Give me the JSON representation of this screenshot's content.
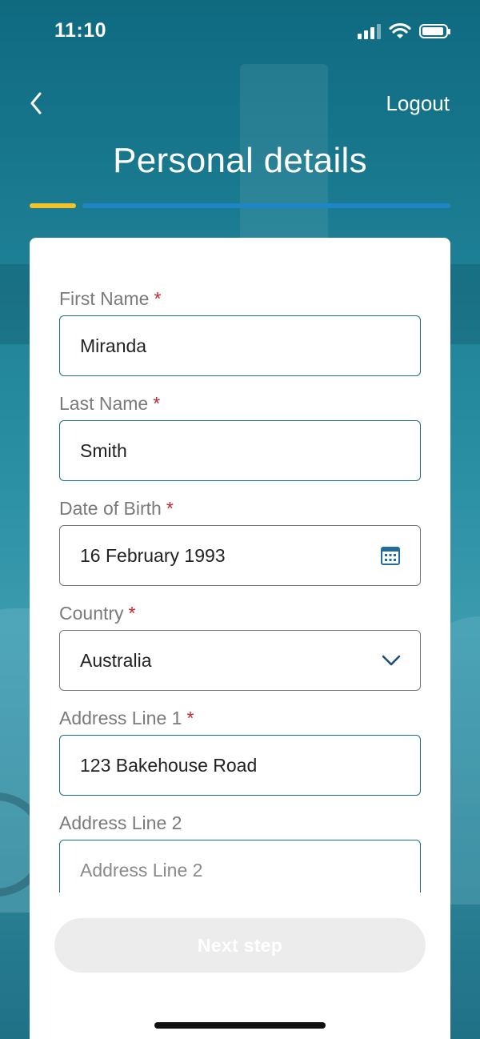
{
  "status_bar": {
    "time": "11:10"
  },
  "header": {
    "logout_label": "Logout",
    "title": "Personal details"
  },
  "progress": {
    "current_step": 1,
    "fraction_complete": 0.11
  },
  "form": {
    "first_name": {
      "label": "First Name",
      "required_mark": "*",
      "value": "Miranda"
    },
    "last_name": {
      "label": "Last Name",
      "required_mark": "*",
      "value": "Smith"
    },
    "date_of_birth": {
      "label": "Date of Birth",
      "required_mark": "*",
      "value": "16 February 1993"
    },
    "country": {
      "label": "Country",
      "required_mark": "*",
      "value": "Australia"
    },
    "address_line_1": {
      "label": "Address Line 1",
      "required_mark": "*",
      "value": "123 Bakehouse Road"
    },
    "address_line_2": {
      "label": "Address Line 2",
      "placeholder": "Address Line 2"
    }
  },
  "actions": {
    "next_label": "Next step"
  },
  "colors": {
    "accent_yellow": "#f2c22b",
    "accent_blue": "#1f86c6",
    "field_border": "#1d6f87",
    "required_red": "#c0262d"
  },
  "icons": [
    "back-chevron-icon",
    "signal-icon",
    "wifi-icon",
    "battery-icon",
    "calendar-icon",
    "chevron-down-icon"
  ]
}
